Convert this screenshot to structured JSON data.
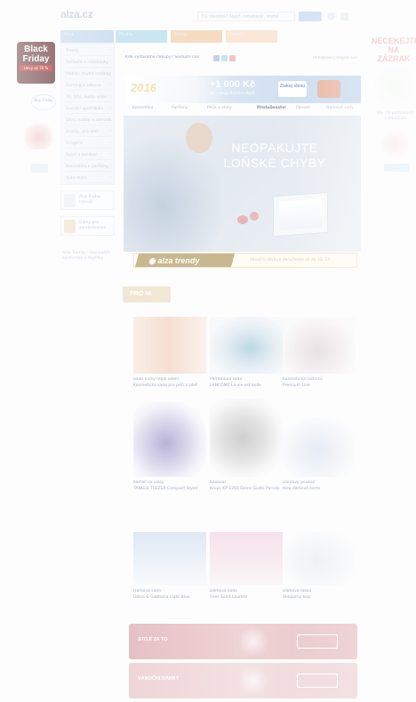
{
  "header": {
    "logo": "alza.cz",
    "search_placeholder": "Co hledáte? Např. notebook, mobil",
    "search_label": "Hledat"
  },
  "tabs": [
    {
      "label": "Alza",
      "color": "#cfdff1"
    },
    {
      "label": "Media",
      "color": "#c9e6f2"
    },
    {
      "label": "Dárky",
      "color": "#f6dcc1"
    },
    {
      "label": "Trendy",
      "color": "#fbe7d6"
    }
  ],
  "sidebar": {
    "items": [
      {
        "label": "Trendy"
      },
      {
        "label": "Počítače a notebooky"
      },
      {
        "label": "Mobily, chytré hodinky"
      },
      {
        "label": "Gaming a zábava"
      },
      {
        "label": "TV, foto, audio-video"
      },
      {
        "label": "Domácí spotřebiče"
      },
      {
        "label": "Dům, hobby a zahrada"
      },
      {
        "label": "Hračky, pro děti"
      },
      {
        "label": "Drogerie"
      },
      {
        "label": "Sport a outdoor"
      },
      {
        "label": "Kosmetika a parfémy"
      },
      {
        "label": "Auto-moto"
      }
    ],
    "promos": [
      {
        "label": "Alza Kniha trendů",
        "color": "#f0f3f7"
      },
      {
        "label": "Dárky pro zaměstnance",
        "color": "#f5ecdc"
      }
    ],
    "footer_text": "Alza Trendy – nejnovější kosmetika a doplňky"
  },
  "left_ad": {
    "title": "Black Friday",
    "badge": "slevy až 70 %",
    "bubble": "Buy Friday",
    "colors": {
      "bg": "#6b3b3b",
      "badge": "#b33333"
    }
  },
  "right_ad": {
    "title": "NECEKEJTE NA ZÁZRAK",
    "caption": "Vše, co potřebujete k Vánocům"
  },
  "info_bar": {
    "text": "Kde vydáváme nákupy? Sledujte nás",
    "login": "Přihlášení | Registrace"
  },
  "promo_banner": {
    "year": "2016",
    "headline": "+1 000 Kč",
    "subline": "na nákup dalšího zboží",
    "button": "Získej slevu"
  },
  "secondary_nav": [
    {
      "label": "Kosmetika"
    },
    {
      "label": "Parfémy"
    },
    {
      "label": "Péče o vlasy"
    },
    {
      "label": "Příslušenství"
    },
    {
      "label": "Pánské"
    },
    {
      "label": "Dárkové sady"
    }
  ],
  "hero": {
    "headline_line1": "NEOPAKUJTE",
    "headline_line2": "LOŇSKÉ CHYBY",
    "badge": "alza trendy",
    "footer_text": "Vánoční dárky s doručením až do 23. 12."
  },
  "section": {
    "title": "PRO NI"
  },
  "products": [
    {
      "name": "Sada Vichy Ideal Soleil",
      "desc": "Kosmetická sada pro péči o pleť"
    },
    {
      "name": "Parfémová sada",
      "desc": "LANCÔME La vie est belle"
    },
    {
      "name": "Kosmetická taštička",
      "desc": "Premium Line"
    },
    {
      "name": "Kartáč na vlasy",
      "desc": "TANGLE TEEZER Compact Styler"
    },
    {
      "name": "Kávovar",
      "desc": "Krups KP 1201 Dolce Gusto Piccolo"
    },
    {
      "name": "Dárkový poukaz",
      "desc": "Alza dárková karta"
    },
    {
      "name": "Dárková sada",
      "desc": "Dolce & Gabbana Light Blue"
    },
    {
      "name": "Dárková sada",
      "desc": "Yves Saint Laurent"
    },
    {
      "name": "Dárková taška",
      "desc": "Shopping bag"
    }
  ],
  "strips": [
    {
      "label": "STOJÍ ZA TO",
      "color": "#e2b9bd"
    },
    {
      "label": "VÁNOČNÍ DÁRKY",
      "color": "#eccdd0"
    }
  ]
}
